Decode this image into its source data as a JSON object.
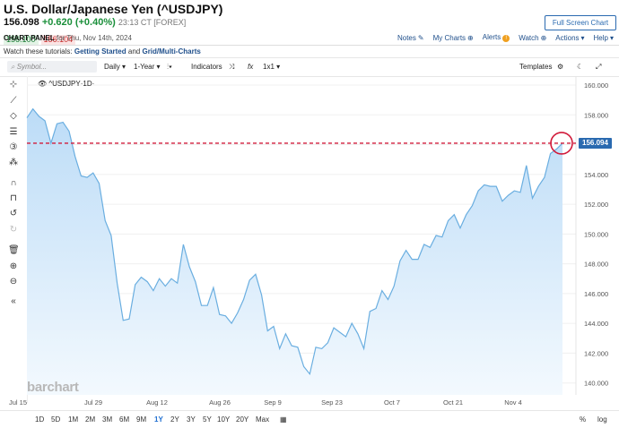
{
  "header": {
    "title": "U.S. Dollar/Japanese Yen (^USDJPY)",
    "price": "156.098",
    "change": "+0.620 (+0.40%)",
    "time": "23:13 CT [FOREX]",
    "bid": "156.100",
    "ask": "156.104",
    "panel_label": "CHART PANEL",
    "panel_date": "for Thu, Nov 14th, 2024",
    "fullscreen_label": "Full Screen Chart"
  },
  "toplinks": {
    "notes": "Notes",
    "my_charts": "My Charts",
    "alerts": "Alerts",
    "watch": "Watch",
    "actions": "Actions",
    "help": "Help"
  },
  "tutorial": {
    "prefix": "Watch these tutorials:",
    "link1": "Getting Started",
    "and": "and",
    "link2": "Grid/Multi-Charts"
  },
  "toolbar": {
    "symbol_placeholder": "Symbol...",
    "interval": "Daily",
    "range": "1-Year",
    "indicators": "Indicators",
    "fx": "fx",
    "layout": "1x1",
    "templates": "Templates"
  },
  "legend": "^USDJPY·1D·",
  "brand": "barchart",
  "last_price_tag": "156.094",
  "range_buttons": [
    "1D",
    "5D",
    "1M",
    "2M",
    "3M",
    "6M",
    "9M",
    "1Y",
    "2Y",
    "3Y",
    "5Y",
    "10Y",
    "20Y",
    "Max"
  ],
  "active_range": "1Y",
  "bottom_right": {
    "percent": "%",
    "log": "log"
  },
  "colors": {
    "line": "#6aaee0",
    "fill_top": "#cfe6fa",
    "accent": "#1f6fd1",
    "last_line": "#d11a3a",
    "up": "#1a8f3a"
  },
  "chart_data": {
    "type": "area",
    "title": "^USDJPY·1D·",
    "y_ticks": [
      140.0,
      142.0,
      144.0,
      146.0,
      148.0,
      150.0,
      152.0,
      154.0,
      156.0,
      158.0,
      160.0
    ],
    "x_ticks": [
      "Jul 15",
      "Jul 29",
      "Aug 12",
      "Aug 26",
      "Sep 9",
      "Sep 23",
      "Oct 7",
      "Oct 21",
      "Nov 4"
    ],
    "ylim": [
      139.2,
      160.6
    ],
    "last_value": 156.094,
    "values": [
      157.8,
      158.4,
      157.9,
      157.6,
      156.1,
      157.4,
      157.5,
      156.9,
      155.2,
      153.9,
      153.8,
      154.1,
      153.4,
      150.9,
      149.9,
      146.7,
      144.2,
      144.3,
      146.6,
      147.1,
      146.8,
      146.2,
      147.0,
      146.5,
      147.0,
      146.7,
      149.3,
      147.8,
      146.8,
      145.2,
      145.2,
      146.4,
      144.6,
      144.5,
      144.0,
      144.7,
      145.6,
      146.9,
      147.3,
      145.9,
      143.5,
      143.8,
      142.3,
      143.3,
      142.5,
      142.4,
      141.1,
      140.6,
      142.4,
      142.3,
      142.7,
      143.7,
      143.4,
      143.1,
      144.0,
      143.3,
      142.3,
      144.8,
      145.0,
      146.2,
      145.6,
      146.5,
      148.2,
      148.9,
      148.3,
      148.3,
      149.3,
      149.1,
      149.9,
      149.8,
      150.9,
      151.3,
      150.4,
      151.3,
      151.9,
      152.9,
      153.3,
      153.2,
      153.2,
      152.2,
      152.6,
      152.9,
      152.8,
      154.6,
      152.4,
      153.2,
      153.8,
      155.4,
      155.7,
      156.1
    ]
  }
}
